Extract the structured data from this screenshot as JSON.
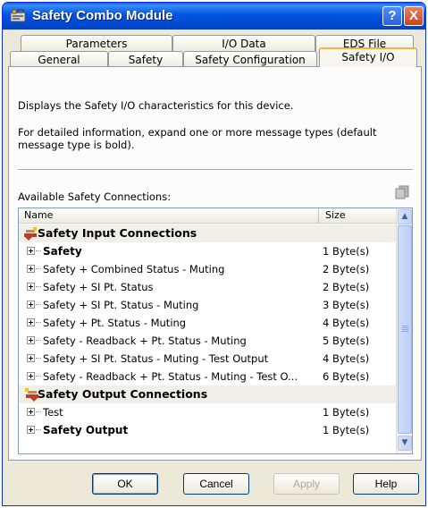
{
  "window": {
    "title": "Safety Combo Module",
    "help_label": "?",
    "close_label": "X"
  },
  "tabs": {
    "back_row": [
      {
        "label": "Parameters"
      },
      {
        "label": "I/O Data"
      },
      {
        "label": "EDS File"
      }
    ],
    "front_row": [
      {
        "label": "General"
      },
      {
        "label": "Safety"
      },
      {
        "label": "Safety Configuration"
      },
      {
        "label": "Safety I/O"
      }
    ],
    "active": "Safety I/O"
  },
  "panel": {
    "description": "Displays the Safety I/O characteristics for this device.",
    "details": "For detailed information, expand one or more message types (default message type is bold).",
    "available_label": "Available Safety Connections:"
  },
  "list": {
    "columns": {
      "name": "Name",
      "size": "Size"
    },
    "rows": [
      {
        "type": "group",
        "name": "Safety Input Connections"
      },
      {
        "type": "item",
        "name": "Safety",
        "size": "1 Byte(s)",
        "bold": true
      },
      {
        "type": "item",
        "name": "Safety + Combined Status - Muting",
        "size": "2 Byte(s)"
      },
      {
        "type": "item",
        "name": "Safety + SI Pt. Status",
        "size": "2 Byte(s)"
      },
      {
        "type": "item",
        "name": "Safety + SI Pt. Status - Muting",
        "size": "3 Byte(s)"
      },
      {
        "type": "item",
        "name": "Safety + Pt. Status - Muting",
        "size": "4 Byte(s)"
      },
      {
        "type": "item",
        "name": "Safety - Readback + Pt. Status - Muting",
        "size": "5 Byte(s)"
      },
      {
        "type": "item",
        "name": "Safety + SI Pt. Status - Muting - Test Output",
        "size": "4 Byte(s)"
      },
      {
        "type": "item",
        "name": "Safety - Readback + Pt. Status - Muting - Test O...",
        "size": "6 Byte(s)"
      },
      {
        "type": "group",
        "name": "Safety Output Connections"
      },
      {
        "type": "item",
        "name": "Test",
        "size": "1 Byte(s)"
      },
      {
        "type": "item",
        "name": "Safety Output",
        "size": "1 Byte(s)",
        "bold": true
      }
    ]
  },
  "buttons": {
    "ok": "OK",
    "cancel": "Cancel",
    "apply": "Apply",
    "help": "Help"
  },
  "colors": {
    "titlebar": "#0054e3",
    "active_tab_accent": "#f5b53a",
    "connection_icon": "#c0392b"
  }
}
